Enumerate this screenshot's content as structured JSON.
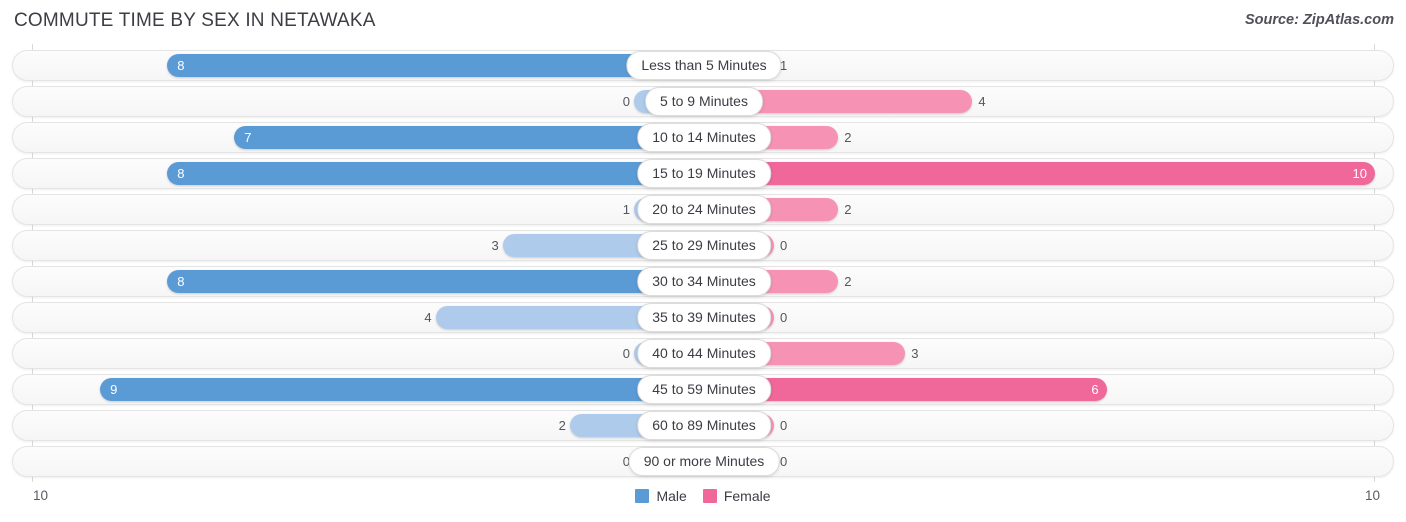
{
  "header": {
    "title": "COMMUTE TIME BY SEX IN NETAWAKA",
    "source": "Source: ZipAtlas.com"
  },
  "legend": {
    "male_label": "Male",
    "female_label": "Female",
    "male_color": "#5b9bd5",
    "female_color": "#f0679a"
  },
  "axis": {
    "left_label": "10",
    "right_label": "10"
  },
  "colors": {
    "male_high": "#5b9bd5",
    "male_low": "#aecbeb",
    "female_high": "#f0679a",
    "female_low": "#f693b4",
    "track_bg": "#f7f7f7",
    "track_border": "#e4e4e4",
    "gridline": "#d9d9d9"
  },
  "chart_data": {
    "type": "bar",
    "title": "COMMUTE TIME BY SEX IN NETAWAKA",
    "subtitle": "Source: ZipAtlas.com",
    "orientation": "horizontal-diverging",
    "xlabel": "",
    "ylabel": "",
    "xlim": [
      10,
      10
    ],
    "grid": true,
    "legend_position": "bottom-center",
    "categories": [
      "Less than 5 Minutes",
      "5 to 9 Minutes",
      "10 to 14 Minutes",
      "15 to 19 Minutes",
      "20 to 24 Minutes",
      "25 to 29 Minutes",
      "30 to 34 Minutes",
      "35 to 39 Minutes",
      "40 to 44 Minutes",
      "45 to 59 Minutes",
      "60 to 89 Minutes",
      "90 or more Minutes"
    ],
    "series": [
      {
        "name": "Male",
        "values": [
          8,
          0,
          7,
          8,
          1,
          3,
          8,
          4,
          0,
          9,
          2,
          0
        ]
      },
      {
        "name": "Female",
        "values": [
          1,
          4,
          2,
          10,
          2,
          0,
          2,
          0,
          3,
          6,
          0,
          0
        ]
      }
    ]
  },
  "rows": [
    {
      "label": "Less than 5 Minutes",
      "male": "8",
      "female": "1"
    },
    {
      "label": "5 to 9 Minutes",
      "male": "0",
      "female": "4"
    },
    {
      "label": "10 to 14 Minutes",
      "male": "7",
      "female": "2"
    },
    {
      "label": "15 to 19 Minutes",
      "male": "8",
      "female": "10"
    },
    {
      "label": "20 to 24 Minutes",
      "male": "1",
      "female": "2"
    },
    {
      "label": "25 to 29 Minutes",
      "male": "3",
      "female": "0"
    },
    {
      "label": "30 to 34 Minutes",
      "male": "8",
      "female": "2"
    },
    {
      "label": "35 to 39 Minutes",
      "male": "4",
      "female": "0"
    },
    {
      "label": "40 to 44 Minutes",
      "male": "0",
      "female": "3"
    },
    {
      "label": "45 to 59 Minutes",
      "male": "9",
      "female": "6"
    },
    {
      "label": "60 to 89 Minutes",
      "male": "2",
      "female": "0"
    },
    {
      "label": "90 or more Minutes",
      "male": "0",
      "female": "0"
    }
  ]
}
